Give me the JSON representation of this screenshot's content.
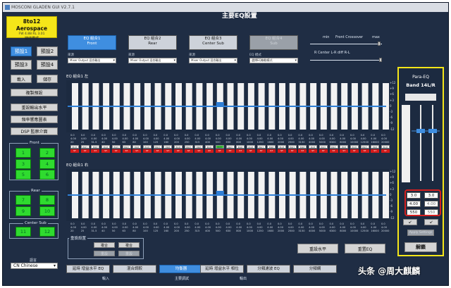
{
  "window": {
    "title": "MOSCONI GLADEN GUI V2.7.1"
  },
  "brand": {
    "name": "8to12 Aerospace",
    "firmware": "FW 4.88   RL 3.01",
    "mode": "鏈結模式"
  },
  "presets": [
    {
      "label": "預設1",
      "selected": true
    },
    {
      "label": "預設2",
      "selected": false
    },
    {
      "label": "預設3",
      "selected": false
    },
    {
      "label": "預設4",
      "selected": false
    }
  ],
  "actions": {
    "load": "載入",
    "save": "儲存",
    "copy_preset": "複製預設",
    "reset_input_level": "重設輸出水平",
    "freq_sweep": "頻率響應圖表",
    "dsp_monitor": "DSP 監察介面"
  },
  "channels": {
    "front_label": "Front",
    "front": [
      "1",
      "2",
      "3",
      "4",
      "5",
      "6"
    ],
    "rear_label": "Rear",
    "rear": [
      "7",
      "8",
      "9",
      "10"
    ],
    "center_label": "Center Sub",
    "center": [
      "11",
      "12"
    ]
  },
  "language": {
    "label": "語言",
    "value": "CN Chinese"
  },
  "main": {
    "title": "主要EQ設置"
  },
  "eq_groups": [
    {
      "line1": "EQ 組合1",
      "line2": "Front",
      "selected": true
    },
    {
      "line1": "EQ 組合2",
      "line2": "Rear",
      "selected": false
    },
    {
      "line1": "EQ 組合3",
      "line2": "Center Sub",
      "selected": false
    },
    {
      "line1": "EQ 組合4",
      "line2": "Sub",
      "selected": false
    }
  ],
  "dropdowns": [
    {
      "label": "來源",
      "value": "Mixer Output 混合輸出"
    },
    {
      "label": "來源",
      "value": "Mixer Output 混合輸出"
    },
    {
      "label": "來源",
      "value": "Mixer Output 混合輸出"
    },
    {
      "label": "EQ 模式",
      "value": "選擇EQ聯動模式"
    }
  ],
  "crossover": {
    "min": "min",
    "title": "Front Crossover",
    "max": "max",
    "rl_label": "R  Center L-R  diff  R-L"
  },
  "eq1_left": {
    "title": "EQ 組合1 左"
  },
  "eq1_right": {
    "title": "EQ 組合1 右"
  },
  "gain_scale": [
    "+12",
    "+9",
    "+6",
    "+3",
    "0",
    "-3",
    "-6",
    "-9",
    "-12"
  ],
  "band_gain": "0.0",
  "band_q": "4.00",
  "eq_freqs": [
    "20",
    "25",
    "31.5",
    "40",
    "50",
    "63",
    "80",
    "100",
    "125",
    "160",
    "200",
    "250",
    "315",
    "400",
    "500",
    "630",
    "800",
    "1000",
    "1250",
    "1600",
    "2000",
    "2500",
    "3150",
    "4000",
    "5000",
    "6300",
    "8000",
    "10000",
    "12500",
    "16000",
    "20000"
  ],
  "edit_label": "EDIT",
  "stereo_label": "ST",
  "bottom_left": {
    "label": "重設設置",
    "btn1": "複合",
    "btn2": "複合",
    "btn3": "重設",
    "btn4": "重設"
  },
  "reset_level": "重設水平",
  "reset_eq": "重置EQ",
  "para_eq": {
    "title": "Para-EQ",
    "band": "Band 14L/R",
    "gain_l": "3.0",
    "gain_r": "3.0",
    "q_l": "4.00",
    "q_r": "4.00",
    "freq_l": "550",
    "freq_r": "550",
    "apply": "Apply Settings",
    "unlock": "解鎖"
  },
  "bottom_nav": [
    {
      "label": "延時 增益水平 EQ",
      "selected": false
    },
    {
      "label": "混合調較",
      "selected": false
    },
    {
      "label": "均衡器",
      "selected": true
    },
    {
      "label": "延時 增益水平 相位",
      "selected": false
    },
    {
      "label": "分頻濾波 EQ",
      "selected": false
    },
    {
      "label": "分頻網",
      "selected": false
    }
  ],
  "bottom_sections": {
    "input": "輸入",
    "main": "主要調試",
    "output": "輸出"
  },
  "watermark": "头条 @周大麒麟"
}
